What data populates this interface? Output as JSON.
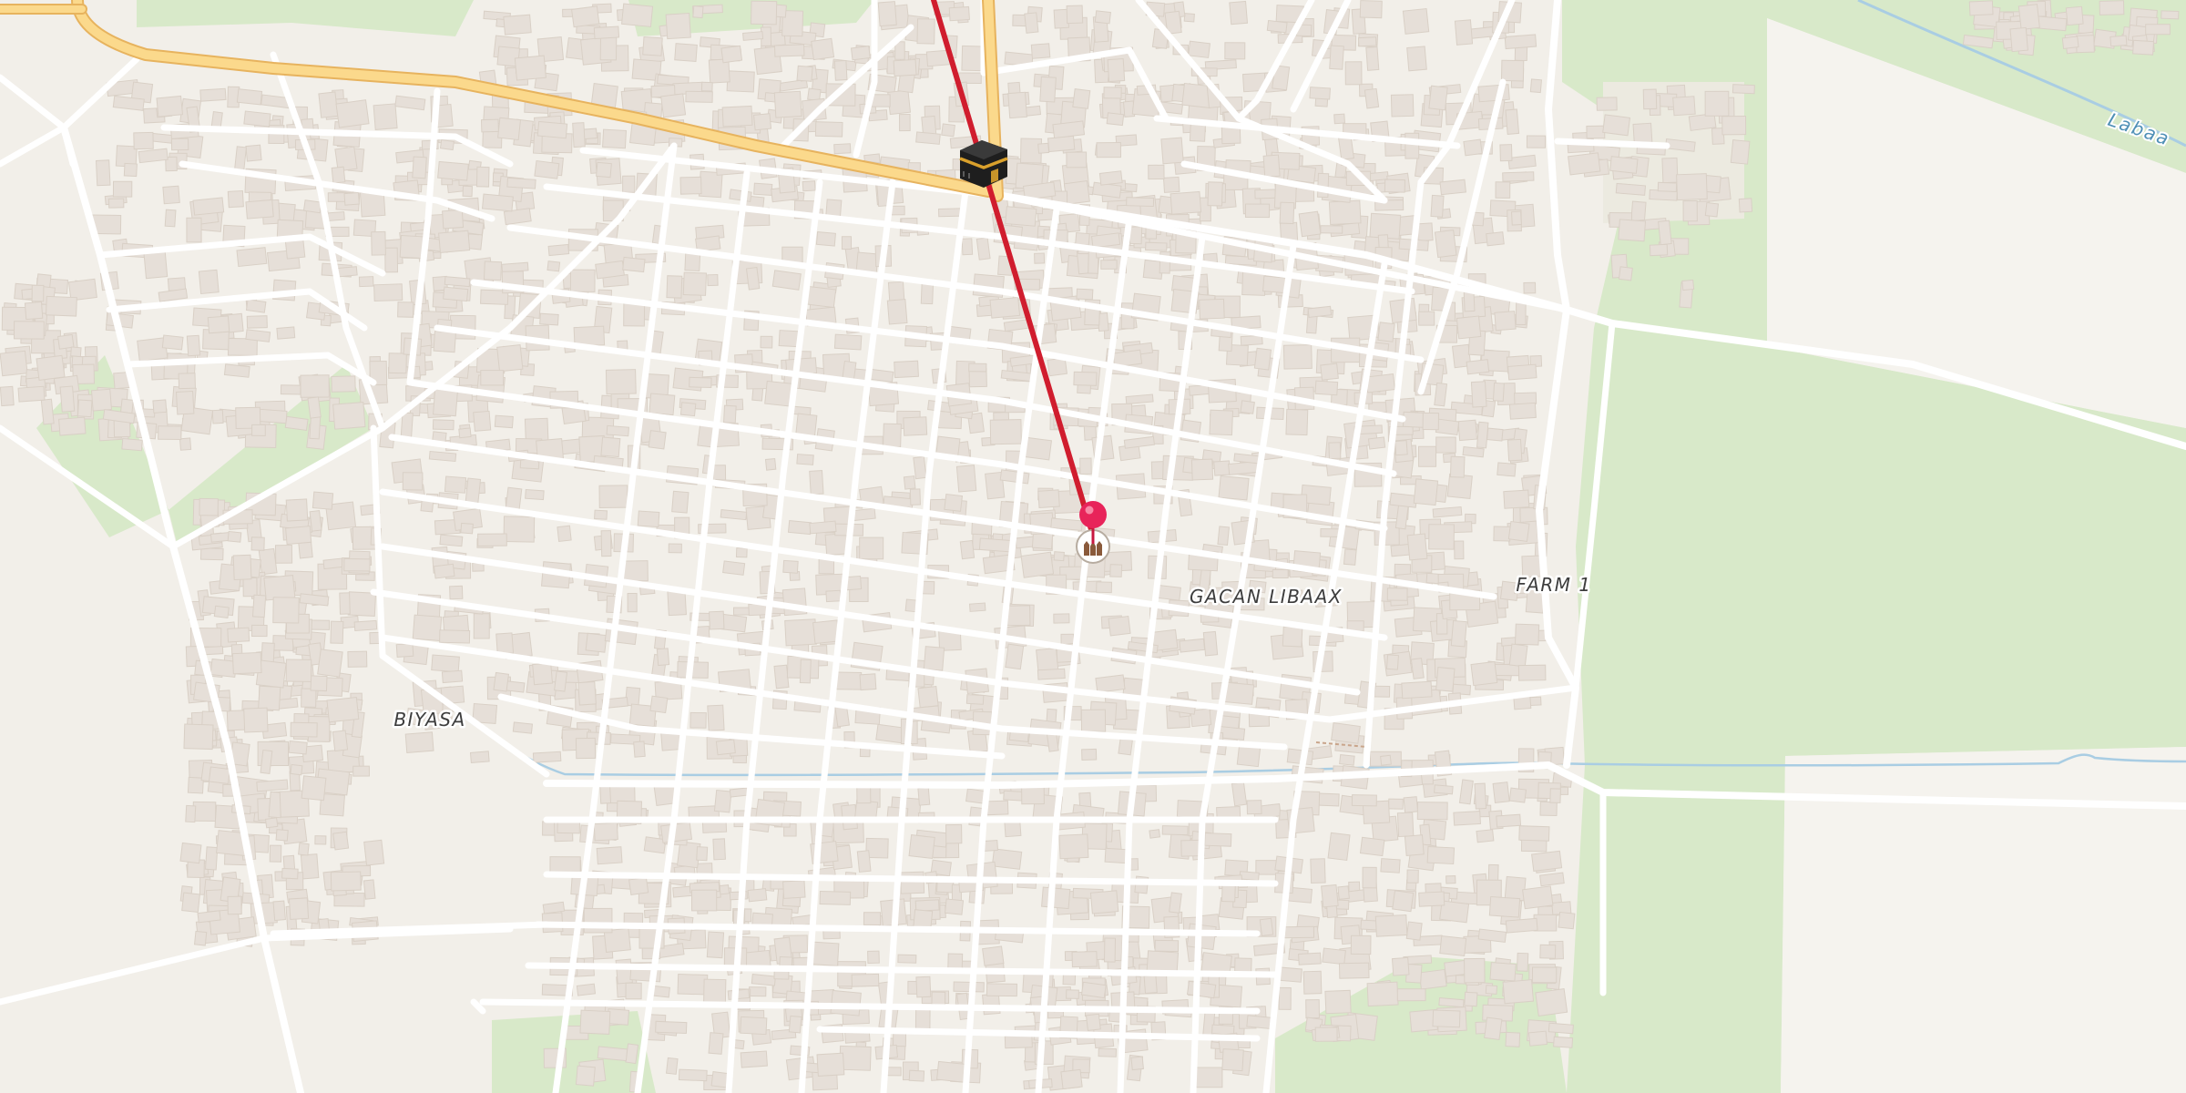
{
  "map": {
    "labels": {
      "gacan_libaax": "GACAN LIBAAX",
      "farm_1": "FARM 1",
      "biyasa": "BIYASA",
      "river": "Labaa"
    },
    "markers": {
      "kaaba": {
        "icon": "kaaba-icon",
        "meaning": "Qibla direction (Mecca)"
      },
      "location_pin": {
        "icon": "map-pin-icon",
        "color": "#e8245a"
      },
      "mosque": {
        "icon": "mosque-icon"
      }
    },
    "colors": {
      "background": "#f2efe9",
      "green_area": "#d8e9c9",
      "road": "#ffffff",
      "major_road": "#fbd98c",
      "major_road_casing": "#e7b35e",
      "building": "#e6dfd8",
      "water": "#a9cde3",
      "qibla_line": "#d01d2e"
    }
  }
}
